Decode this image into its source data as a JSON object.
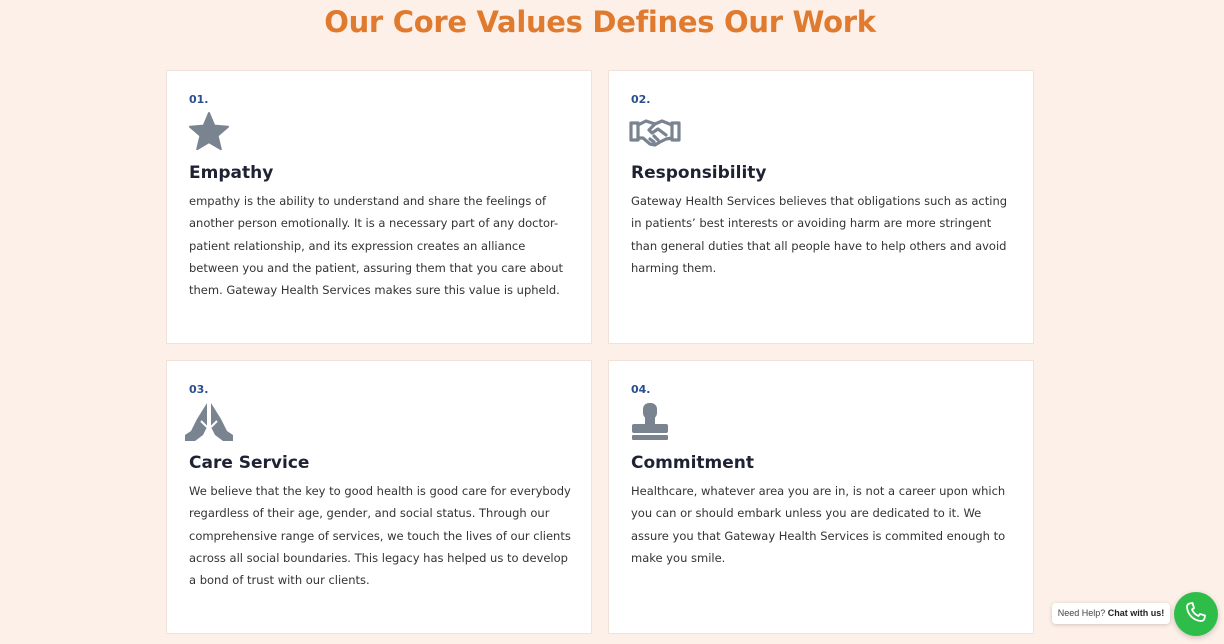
{
  "section": {
    "title": "Our Core Values Defines Our Work"
  },
  "values": [
    {
      "number": "01.",
      "icon": "star-icon",
      "title": "Empathy",
      "text": "empathy is the ability to understand and share the feelings of another person emotionally. It is a necessary part of any doctor-patient relationship, and its expression creates an alliance between you and the patient, assuring them that you care about them. Gateway Health Services makes sure this value is upheld."
    },
    {
      "number": "02.",
      "icon": "handshake-icon",
      "title": "Responsibility",
      "text": "Gateway Health Services believes that obligations such as acting in patients’ best interests  or avoiding harm are more stringent than general duties that all people have to help others and avoid harming them."
    },
    {
      "number": "03.",
      "icon": "praying-hands-icon",
      "title": "Care Service",
      "text": "We believe that the key to good health is good care for everybody regardless of their age, gender, and social status. Through our comprehensive range of services, we touch the lives of our clients across all social boundaries. This legacy has helped us to develop a bond of trust with our clients."
    },
    {
      "number": "04.",
      "icon": "stamp-icon",
      "title": "Commitment",
      "text": "Healthcare, whatever area you are in, is not a career upon which you can or should embark unless you are dedicated to it. We assure you that Gateway Health Services is commited enough to make you smile."
    }
  ],
  "chat": {
    "prefix": "Need Help?",
    "cta": "Chat with us!",
    "icon": "phone-icon"
  },
  "colors": {
    "background": "#fdf0e8",
    "title": "#e07a2e",
    "number": "#2a4f8f",
    "icon": "#7a8491",
    "chat_button": "#2fbd4a"
  }
}
